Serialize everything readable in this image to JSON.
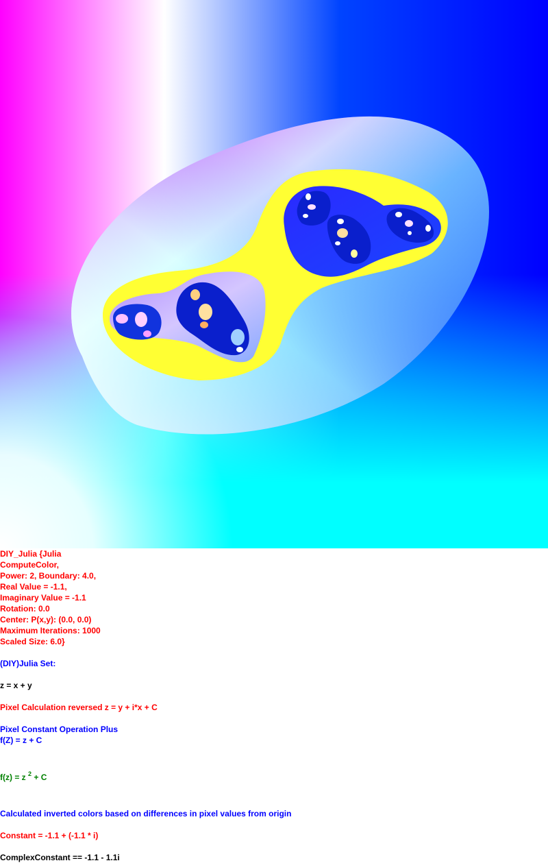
{
  "colors": {
    "magenta": "#ff00ff",
    "blue": "#0000ff",
    "cyan": "#00ffff",
    "yellow": "#ffff33",
    "dark_blue": "#0000cc",
    "text_red": "#ff0000",
    "text_blue": "#0000ff",
    "text_green": "#008000"
  },
  "params": {
    "l1": "DIY_Julia {Julia",
    "l2": "ComputeColor,",
    "l3": "Power: 2, Boundary: 4.0,",
    "l4": "Real Value = -1.1,",
    "l5": "Imaginary Value = -1.1",
    "l6": "Rotation: 0.0",
    "l7": "Center: P(x,y): (0.0, 0.0)",
    "l8": "Maximum Iterations: 1000",
    "l9": "Scaled Size: 6.0}"
  },
  "set_title": "(DIY)Julia Set:",
  "z_def": "z = x + y",
  "pixel_calc": "Pixel Calculation reversed z = y + i*x + C",
  "pixel_op": "Pixel Constant Operation Plus",
  "f_plus": "f(Z) = z + C",
  "formula": {
    "lhs": "f(z) = z ",
    "exp": "2",
    "rhs": " + C"
  },
  "color_note": "Calculated inverted colors based on differences in pixel values from origin",
  "constant": "Constant = -1.1 + (-1.1 * i)",
  "complex_constant": "ComplexConstant == -1.1 - 1.1i"
}
